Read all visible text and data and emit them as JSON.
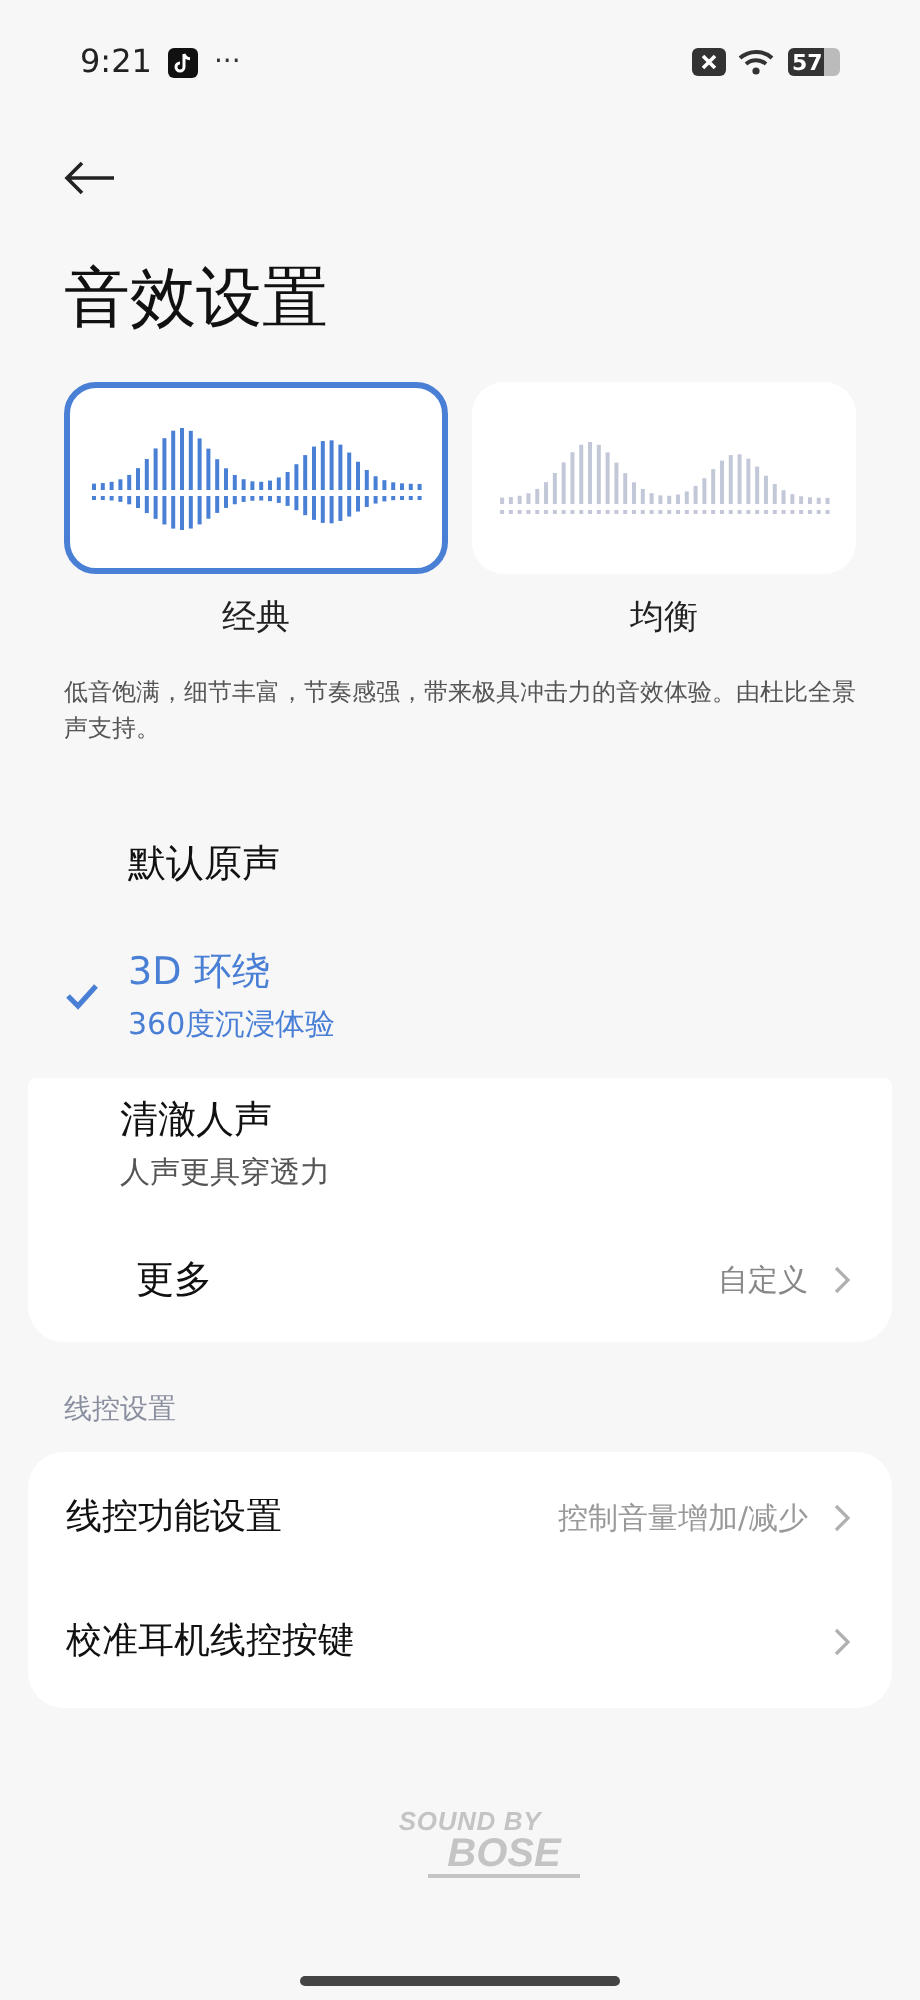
{
  "status_bar": {
    "time": "9:21",
    "more": "···",
    "battery": "57"
  },
  "title": "音效设置",
  "presets": [
    {
      "label": "经典",
      "selected": true
    },
    {
      "label": "均衡",
      "selected": false
    }
  ],
  "description": "低音饱满，细节丰富，节奏感强，带来极具冲击力的音效体验。由杜比全景声支持。",
  "modes": [
    {
      "title": "默认原声",
      "selected": false
    },
    {
      "title": "3D 环绕",
      "subtitle": "360度沉浸体验",
      "selected": true
    },
    {
      "title": "清澈人声",
      "subtitle": "人声更具穿透力",
      "selected": false
    }
  ],
  "more": {
    "label": "更多",
    "value": "自定义"
  },
  "wire_section": {
    "header": "线控设置",
    "rows": [
      {
        "label": "线控功能设置",
        "value": "控制音量增加/减少"
      },
      {
        "label": "校准耳机线控按键"
      }
    ]
  },
  "footer": {
    "line1": "SOUND BY",
    "line2": "BOSE"
  }
}
